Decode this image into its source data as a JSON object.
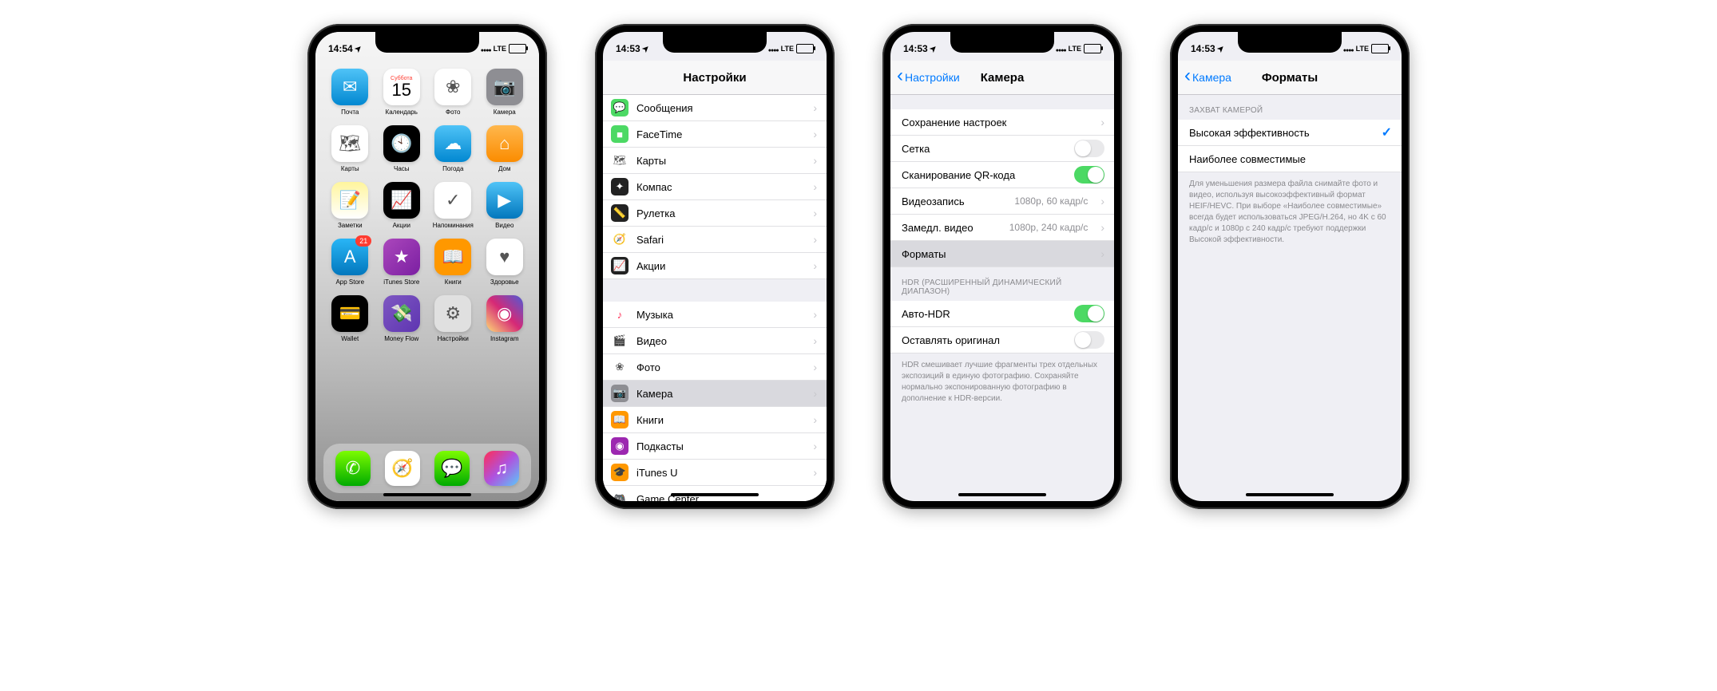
{
  "status": {
    "time1": "14:54",
    "time2": "14:53",
    "lte": "LTE"
  },
  "home": {
    "calendar_day": "Суббота",
    "calendar_num": "15",
    "apps": [
      {
        "label": "Почта",
        "bg": "linear-gradient(180deg,#4fc3f7,#0288d1)",
        "glyph": "✉"
      },
      {
        "label": "Календарь",
        "bg": "#ffffff",
        "glyph": ""
      },
      {
        "label": "Фото",
        "bg": "#ffffff",
        "glyph": "❀"
      },
      {
        "label": "Камера",
        "bg": "#8e8e93",
        "glyph": "📷"
      },
      {
        "label": "Карты",
        "bg": "#ffffff",
        "glyph": "🗺"
      },
      {
        "label": "Часы",
        "bg": "#000000",
        "glyph": "🕙"
      },
      {
        "label": "Погода",
        "bg": "linear-gradient(180deg,#4fc3f7,#0288d1)",
        "glyph": "☁"
      },
      {
        "label": "Дом",
        "bg": "linear-gradient(180deg,#ffb74d,#fb8c00)",
        "glyph": "⌂"
      },
      {
        "label": "Заметки",
        "bg": "linear-gradient(180deg,#fff59d,#fff)",
        "glyph": "📝"
      },
      {
        "label": "Акции",
        "bg": "#000000",
        "glyph": "📈"
      },
      {
        "label": "Напоминания",
        "bg": "#ffffff",
        "glyph": "✓"
      },
      {
        "label": "Видео",
        "bg": "linear-gradient(180deg,#4fc3f7,#0277bd)",
        "glyph": "▶"
      },
      {
        "label": "App Store",
        "bg": "linear-gradient(180deg,#29b6f6,#0277bd)",
        "glyph": "A",
        "badge": "21"
      },
      {
        "label": "iTunes Store",
        "bg": "linear-gradient(135deg,#ab47bc,#7b1fa2)",
        "glyph": "★"
      },
      {
        "label": "Книги",
        "bg": "#ff9800",
        "glyph": "📖"
      },
      {
        "label": "Здоровье",
        "bg": "#ffffff",
        "glyph": "♥"
      },
      {
        "label": "Wallet",
        "bg": "#000000",
        "glyph": "💳"
      },
      {
        "label": "Money Flow",
        "bg": "linear-gradient(135deg,#7e57c2,#5e35b1)",
        "glyph": "💸"
      },
      {
        "label": "Настройки",
        "bg": "#e0e0e0",
        "glyph": "⚙"
      },
      {
        "label": "Instagram",
        "bg": "linear-gradient(45deg,#feda75,#d62976,#4f5bd5)",
        "glyph": "◉"
      }
    ],
    "dock": [
      {
        "bg": "linear-gradient(180deg,#7cfc00,#0a0)",
        "glyph": "✆"
      },
      {
        "bg": "#ffffff",
        "glyph": "🧭"
      },
      {
        "bg": "linear-gradient(180deg,#7cfc00,#0a0)",
        "glyph": "💬"
      },
      {
        "bg": "linear-gradient(135deg,#ff2d55,#af52de,#5ac8fa)",
        "glyph": "♫"
      }
    ]
  },
  "settings": {
    "title": "Настройки",
    "items": [
      {
        "label": "Сообщения",
        "bg": "#4cd964",
        "glyph": "💬"
      },
      {
        "label": "FaceTime",
        "bg": "#4cd964",
        "glyph": "■"
      },
      {
        "label": "Карты",
        "bg": "#ffffff",
        "glyph": "🗺"
      },
      {
        "label": "Компас",
        "bg": "#222",
        "glyph": "✦"
      },
      {
        "label": "Рулетка",
        "bg": "#222",
        "glyph": "📏"
      },
      {
        "label": "Safari",
        "bg": "#ffffff",
        "glyph": "🧭"
      },
      {
        "label": "Акции",
        "bg": "#222",
        "glyph": "📈"
      }
    ],
    "items2": [
      {
        "label": "Музыка",
        "bg": "#ffffff",
        "glyph": "♪",
        "color": "#ff2d55"
      },
      {
        "label": "Видео",
        "bg": "#ffffff",
        "glyph": "🎬"
      },
      {
        "label": "Фото",
        "bg": "#ffffff",
        "glyph": "❀"
      },
      {
        "label": "Камера",
        "bg": "#8e8e93",
        "glyph": "📷",
        "sel": true
      },
      {
        "label": "Книги",
        "bg": "#ff9800",
        "glyph": "📖"
      },
      {
        "label": "Подкасты",
        "bg": "#9c27b0",
        "glyph": "◉"
      },
      {
        "label": "iTunes U",
        "bg": "#ff9800",
        "glyph": "🎓"
      },
      {
        "label": "Game Center",
        "bg": "#ffffff",
        "glyph": "🎮"
      }
    ]
  },
  "camera": {
    "back": "Настройки",
    "title": "Камера",
    "rows": [
      {
        "label": "Сохранение настроек",
        "type": "disclosure"
      },
      {
        "label": "Сетка",
        "type": "switch",
        "on": false
      },
      {
        "label": "Сканирование QR-кода",
        "type": "switch",
        "on": true
      },
      {
        "label": "Видеозапись",
        "type": "detail",
        "detail": "1080p, 60 кадр/с"
      },
      {
        "label": "Замедл. видео",
        "type": "detail",
        "detail": "1080p, 240 кадр/с"
      },
      {
        "label": "Форматы",
        "type": "disclosure",
        "sel": true
      }
    ],
    "hdr_header": "HDR (РАСШИРЕННЫЙ ДИНАМИЧЕСКИЙ ДИАПАЗОН)",
    "hdr": [
      {
        "label": "Авто-HDR",
        "type": "switch",
        "on": true
      },
      {
        "label": "Оставлять оригинал",
        "type": "switch",
        "on": false
      }
    ],
    "hdr_footer": "HDR смешивает лучшие фрагменты трех отдельных экспозиций в единую фотографию. Сохраняйте нормально экспонированную фотографию в дополнение к HDR-версии."
  },
  "formats": {
    "back": "Камера",
    "title": "Форматы",
    "header": "ЗАХВАТ КАМЕРОЙ",
    "rows": [
      {
        "label": "Высокая эффективность",
        "checked": true
      },
      {
        "label": "Наиболее совместимые",
        "checked": false
      }
    ],
    "footer": "Для уменьшения размера файла снимайте фото и видео, используя высокоэффективный формат HEIF/HEVC. При выборе «Наиболее совместимые» всегда будет использоваться JPEG/H.264, но 4K с 60 кадр/с и 1080p с 240 кадр/с требуют поддержки Высокой эффективности."
  }
}
